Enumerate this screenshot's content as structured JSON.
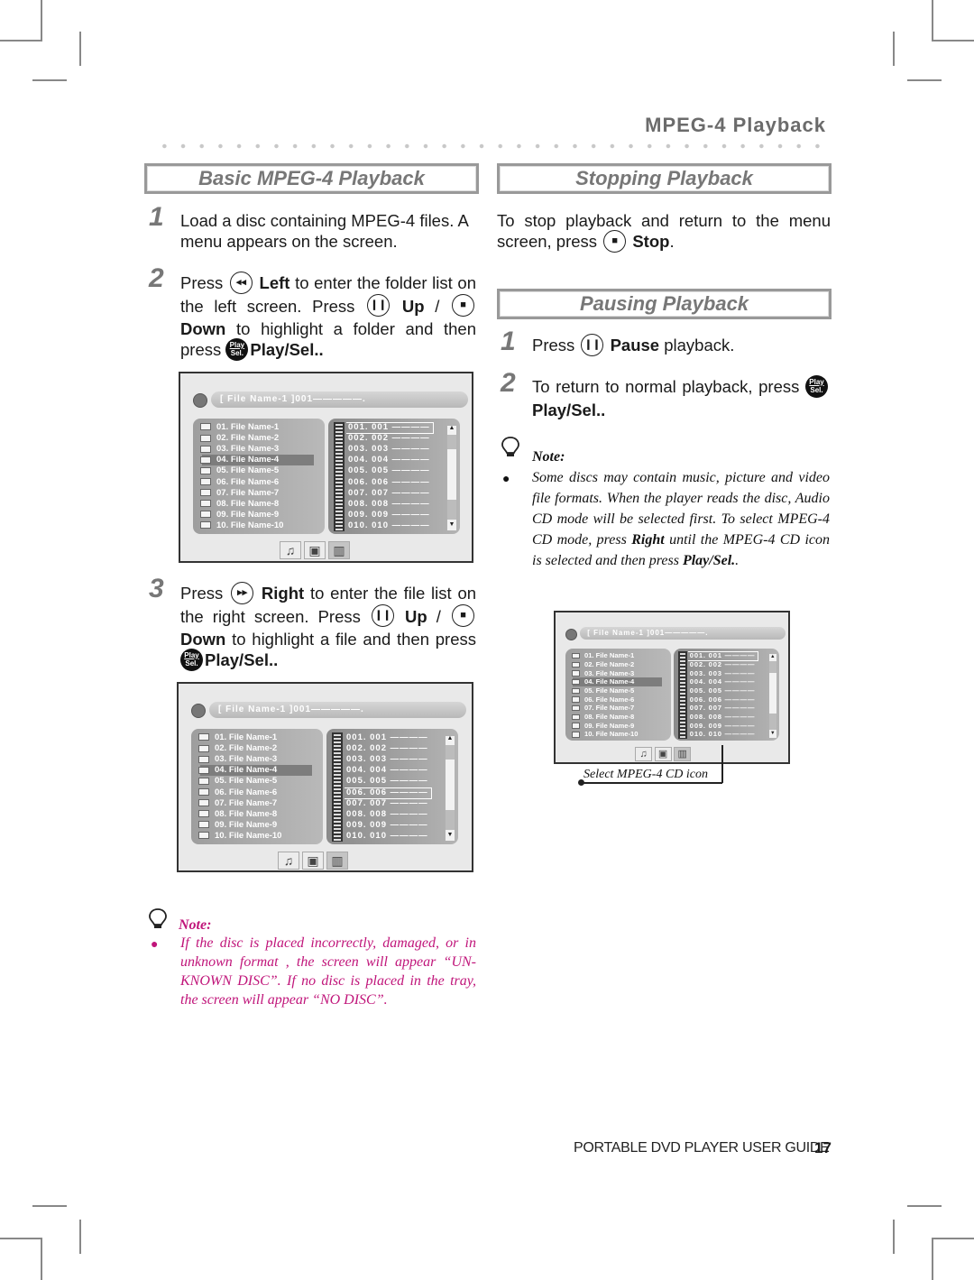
{
  "header": {
    "title": "MPEG-4 Playback"
  },
  "sections": {
    "basic": {
      "title": "Basic MPEG-4 Playback",
      "steps": [
        {
          "num": "1",
          "text": "Load a disc containing MPEG-4 files. A menu appears on the screen."
        },
        {
          "num": "2",
          "pre": "Press",
          "btn1": "Left",
          "mid1": "to enter the folder list on the left screen. Press",
          "btn2": "Up",
          "sep": "/",
          "btn3": "Down",
          "mid2": "to highlight a folder and then press",
          "btn4": "Play/Sel.",
          "end": "."
        },
        {
          "num": "3",
          "pre": "Press",
          "btn1": "Right",
          "mid1": "to enter the file list on the right screen. Press",
          "btn2": "Up",
          "sep": "/",
          "btn3": "Down",
          "mid2": "to highlight a file and then press",
          "btn4": "Play/Sel.",
          "end": "."
        }
      ],
      "note": {
        "title": "Note:",
        "text": "If the disc is placed incorrectly, damaged, or in unknown format , the screen will appear “UN-KNOWN DISC”. If no disc is placed in the tray, the screen will appear “NO DISC”.",
        "color": "#c0157a"
      }
    },
    "stopping": {
      "title": "Stopping Playback",
      "pre": "To stop playback and return to the menu screen, press",
      "btn": "Stop",
      "end": "."
    },
    "pausing": {
      "title": "Pausing Playback",
      "steps": [
        {
          "num": "1",
          "pre": "Press",
          "btn": "Pause",
          "end": "playback."
        },
        {
          "num": "2",
          "pre": "To return to normal playback, press",
          "btn": "Play/Sel.",
          "end": "."
        }
      ],
      "note": {
        "title": "Note:",
        "text1": "Some discs may contain music, picture and video file formats. When the player reads the disc, Audio CD mode will be selected first. To select MPEG-4 CD mode, press ",
        "bold1": "Right",
        "text2": " until the MPEG-4 CD icon is selected and then press ",
        "bold2": "Play/Sel.",
        "text3": "."
      },
      "callout": "Select MPEG-4 CD icon"
    }
  },
  "icons": {
    "left": "◂◂",
    "right": "▸▸",
    "pause": "❙❙",
    "stop": "■",
    "play_sel_top": "Play",
    "play_sel_bottom": "Sel."
  },
  "screen": {
    "path_bar": "[ File Name-1 ]001—————.",
    "folders": [
      "01. File Name-1",
      "02. File Name-2",
      "03. File Name-3",
      "04. File Name-4",
      "05. File Name-5",
      "06. File Name-6",
      "07. File Name-7",
      "08. File Name-8",
      "09. File Name-9",
      "10. File Name-10"
    ],
    "files": [
      "001. 001 ————",
      "002. 002 ————",
      "003. 003 ————",
      "004. 004 ————",
      "005. 005 ————",
      "006. 006 ————",
      "007. 007 ————",
      "008. 008 ————",
      "009. 009 ————",
      "010. 010 ————"
    ],
    "highlighted_folder_index": 3,
    "mode_icons": [
      "music-icon",
      "camera-icon",
      "film-icon"
    ],
    "screens": [
      {
        "selected_file_index": 0
      },
      {
        "selected_file_index": 5
      },
      {
        "selected_file_index": 0
      }
    ]
  },
  "footer": {
    "guide": "PORTABLE DVD PLAYER USER GUIDE",
    "page": "17"
  }
}
